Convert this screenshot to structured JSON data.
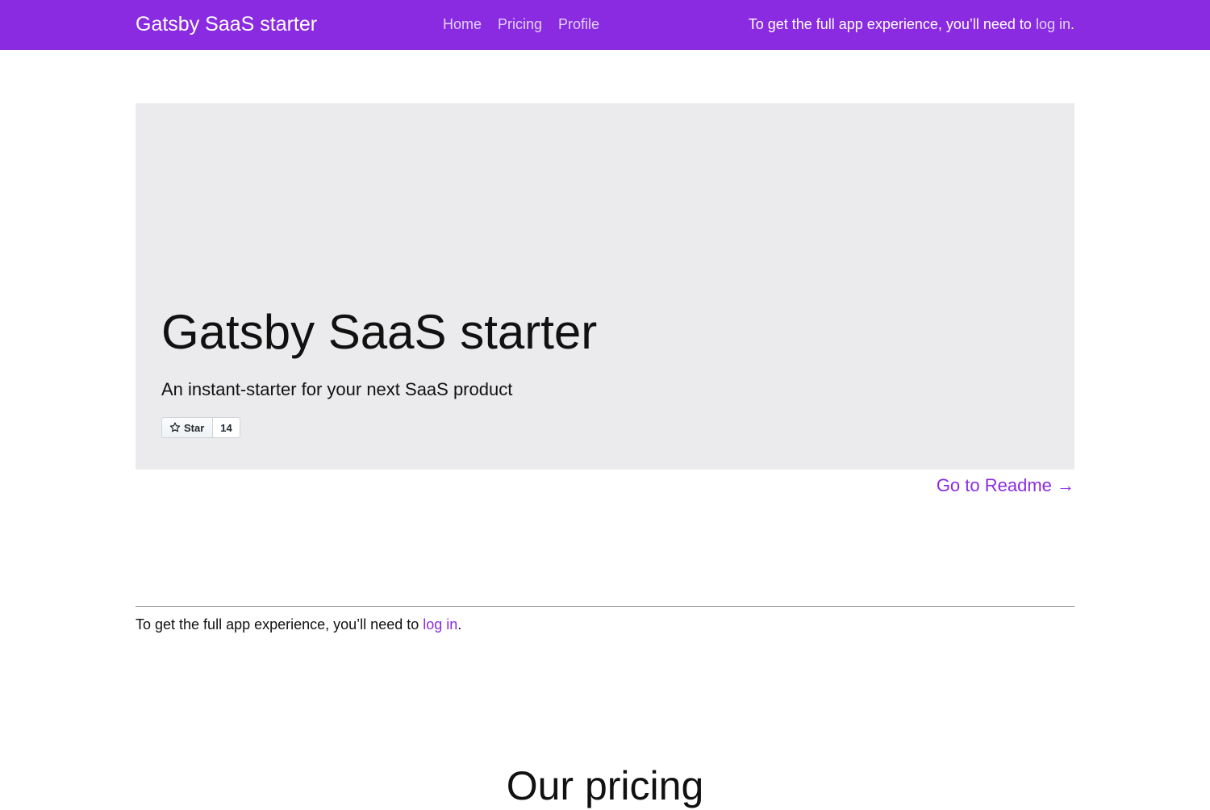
{
  "header": {
    "brand": "Gatsby SaaS starter",
    "nav": [
      {
        "label": "Home"
      },
      {
        "label": "Pricing"
      },
      {
        "label": "Profile"
      }
    ],
    "login_prefix": "To get the full app experience, you’ll need to ",
    "login_link": "log in",
    "login_suffix": "."
  },
  "hero": {
    "title": "Gatsby SaaS starter",
    "subtitle": "An instant-starter for your next SaaS product",
    "star_button": {
      "icon": "star-icon",
      "label": "Star",
      "count": "14"
    }
  },
  "readme_link": "Go to Readme →",
  "bottom_login": {
    "prefix": "To get the full app experience, you’ll need to ",
    "link": "log in",
    "suffix": "."
  },
  "pricing": {
    "title": "Our pricing"
  },
  "colors": {
    "accent": "#8a2be2",
    "hero_bg": "#ebebed",
    "nav_link": "#e2d2f7"
  }
}
